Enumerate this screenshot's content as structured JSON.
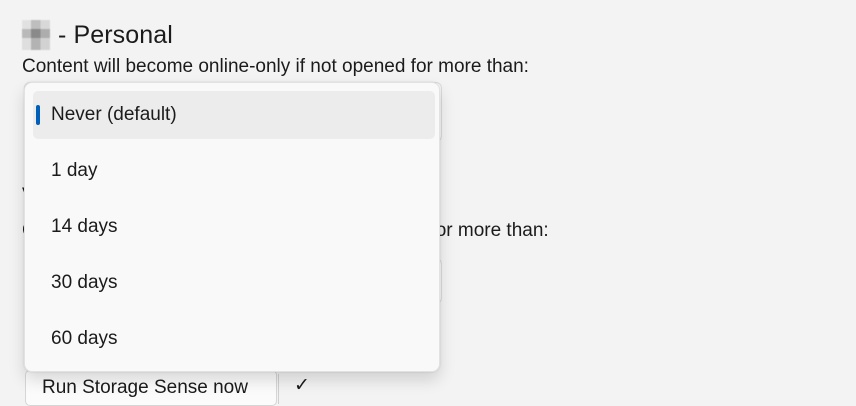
{
  "account": {
    "title": "- Personal"
  },
  "settings": {
    "description_1": "Content will become online-only if not opened for more than:",
    "partial_text_v": "V",
    "partial_text_c": "C",
    "description_2_visible_tail": "ed for more than:"
  },
  "dropdown": {
    "options": [
      {
        "label": "Never (default)",
        "selected": true
      },
      {
        "label": "1 day",
        "selected": false
      },
      {
        "label": "14 days",
        "selected": false
      },
      {
        "label": "30 days",
        "selected": false
      },
      {
        "label": "60 days",
        "selected": false
      }
    ],
    "accent_color": "#005fb8"
  },
  "actions": {
    "run_storage_sense_label": "Run Storage Sense now",
    "check_glyph": "✓"
  }
}
